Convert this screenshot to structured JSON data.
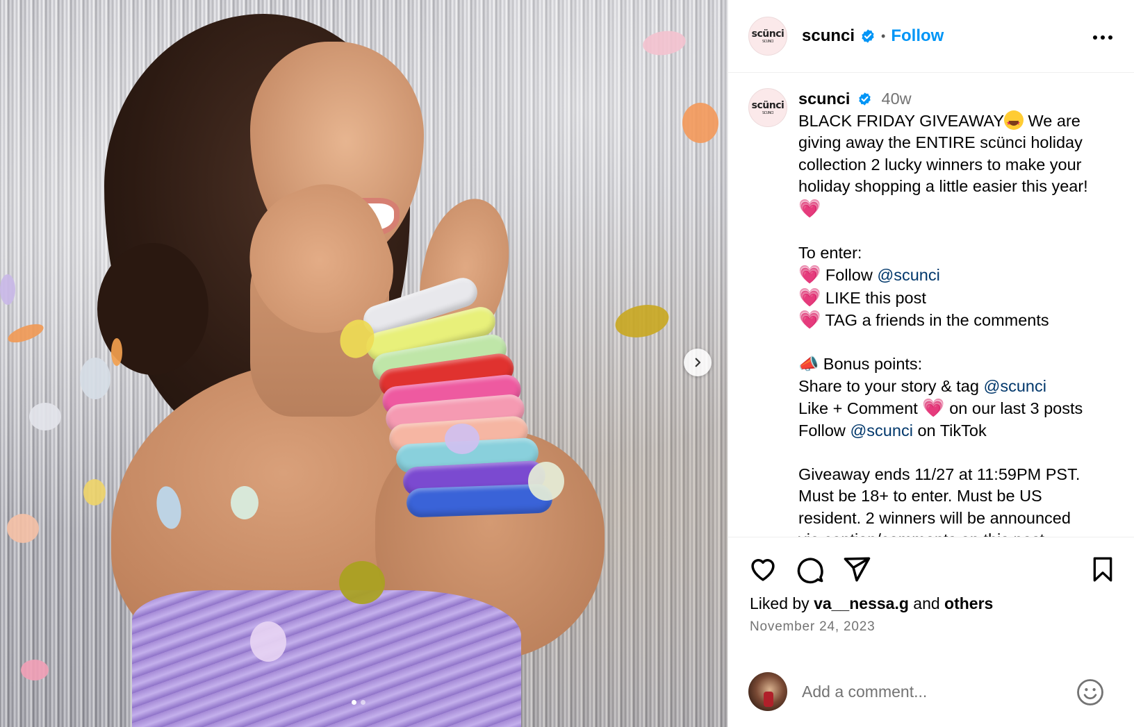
{
  "header": {
    "username": "scunci",
    "separator": "•",
    "follow_label": "Follow",
    "avatar_text": "scünci",
    "avatar_subtext": "SCUNCI"
  },
  "caption": {
    "author": "scunci",
    "time": "40w",
    "lines": [
      "BLACK FRIDAY GIVEAWAY",
      "We are",
      "giving away the ENTIRE scünci holiday",
      "collection 2 lucky winners to make your",
      "holiday shopping a little easier this year!",
      "To enter:",
      "Follow",
      "@scunci",
      "LIKE this post",
      "TAG a friends in the comments",
      "Bonus points:",
      "Share to your story & tag",
      "@scunci",
      "Like + Comment",
      "on our last 3 posts",
      "Follow",
      "@scunci",
      "on TikTok",
      "Giveaway ends 11/27 at 11:59PM PST.",
      "Must be 18+ to enter. Must be US",
      "resident. 2 winners will be announced",
      "via caption/comments on this post."
    ]
  },
  "icons": {
    "heart_emoji": "💗",
    "megaphone_emoji": "📣"
  },
  "engagement": {
    "liked_by_prefix": "Liked by",
    "liked_by_user": "va__nessa.g",
    "liked_by_and": "and",
    "liked_by_others": "others",
    "date": "November 24, 2023"
  },
  "comment": {
    "placeholder": "Add a comment..."
  },
  "colors": {
    "follow_blue": "#0095f6",
    "mention": "#00376b",
    "verified_blue": "#0095f6",
    "secondary_text": "#737373"
  },
  "carousel": {
    "total_slides": 2,
    "active_slide": 1
  }
}
